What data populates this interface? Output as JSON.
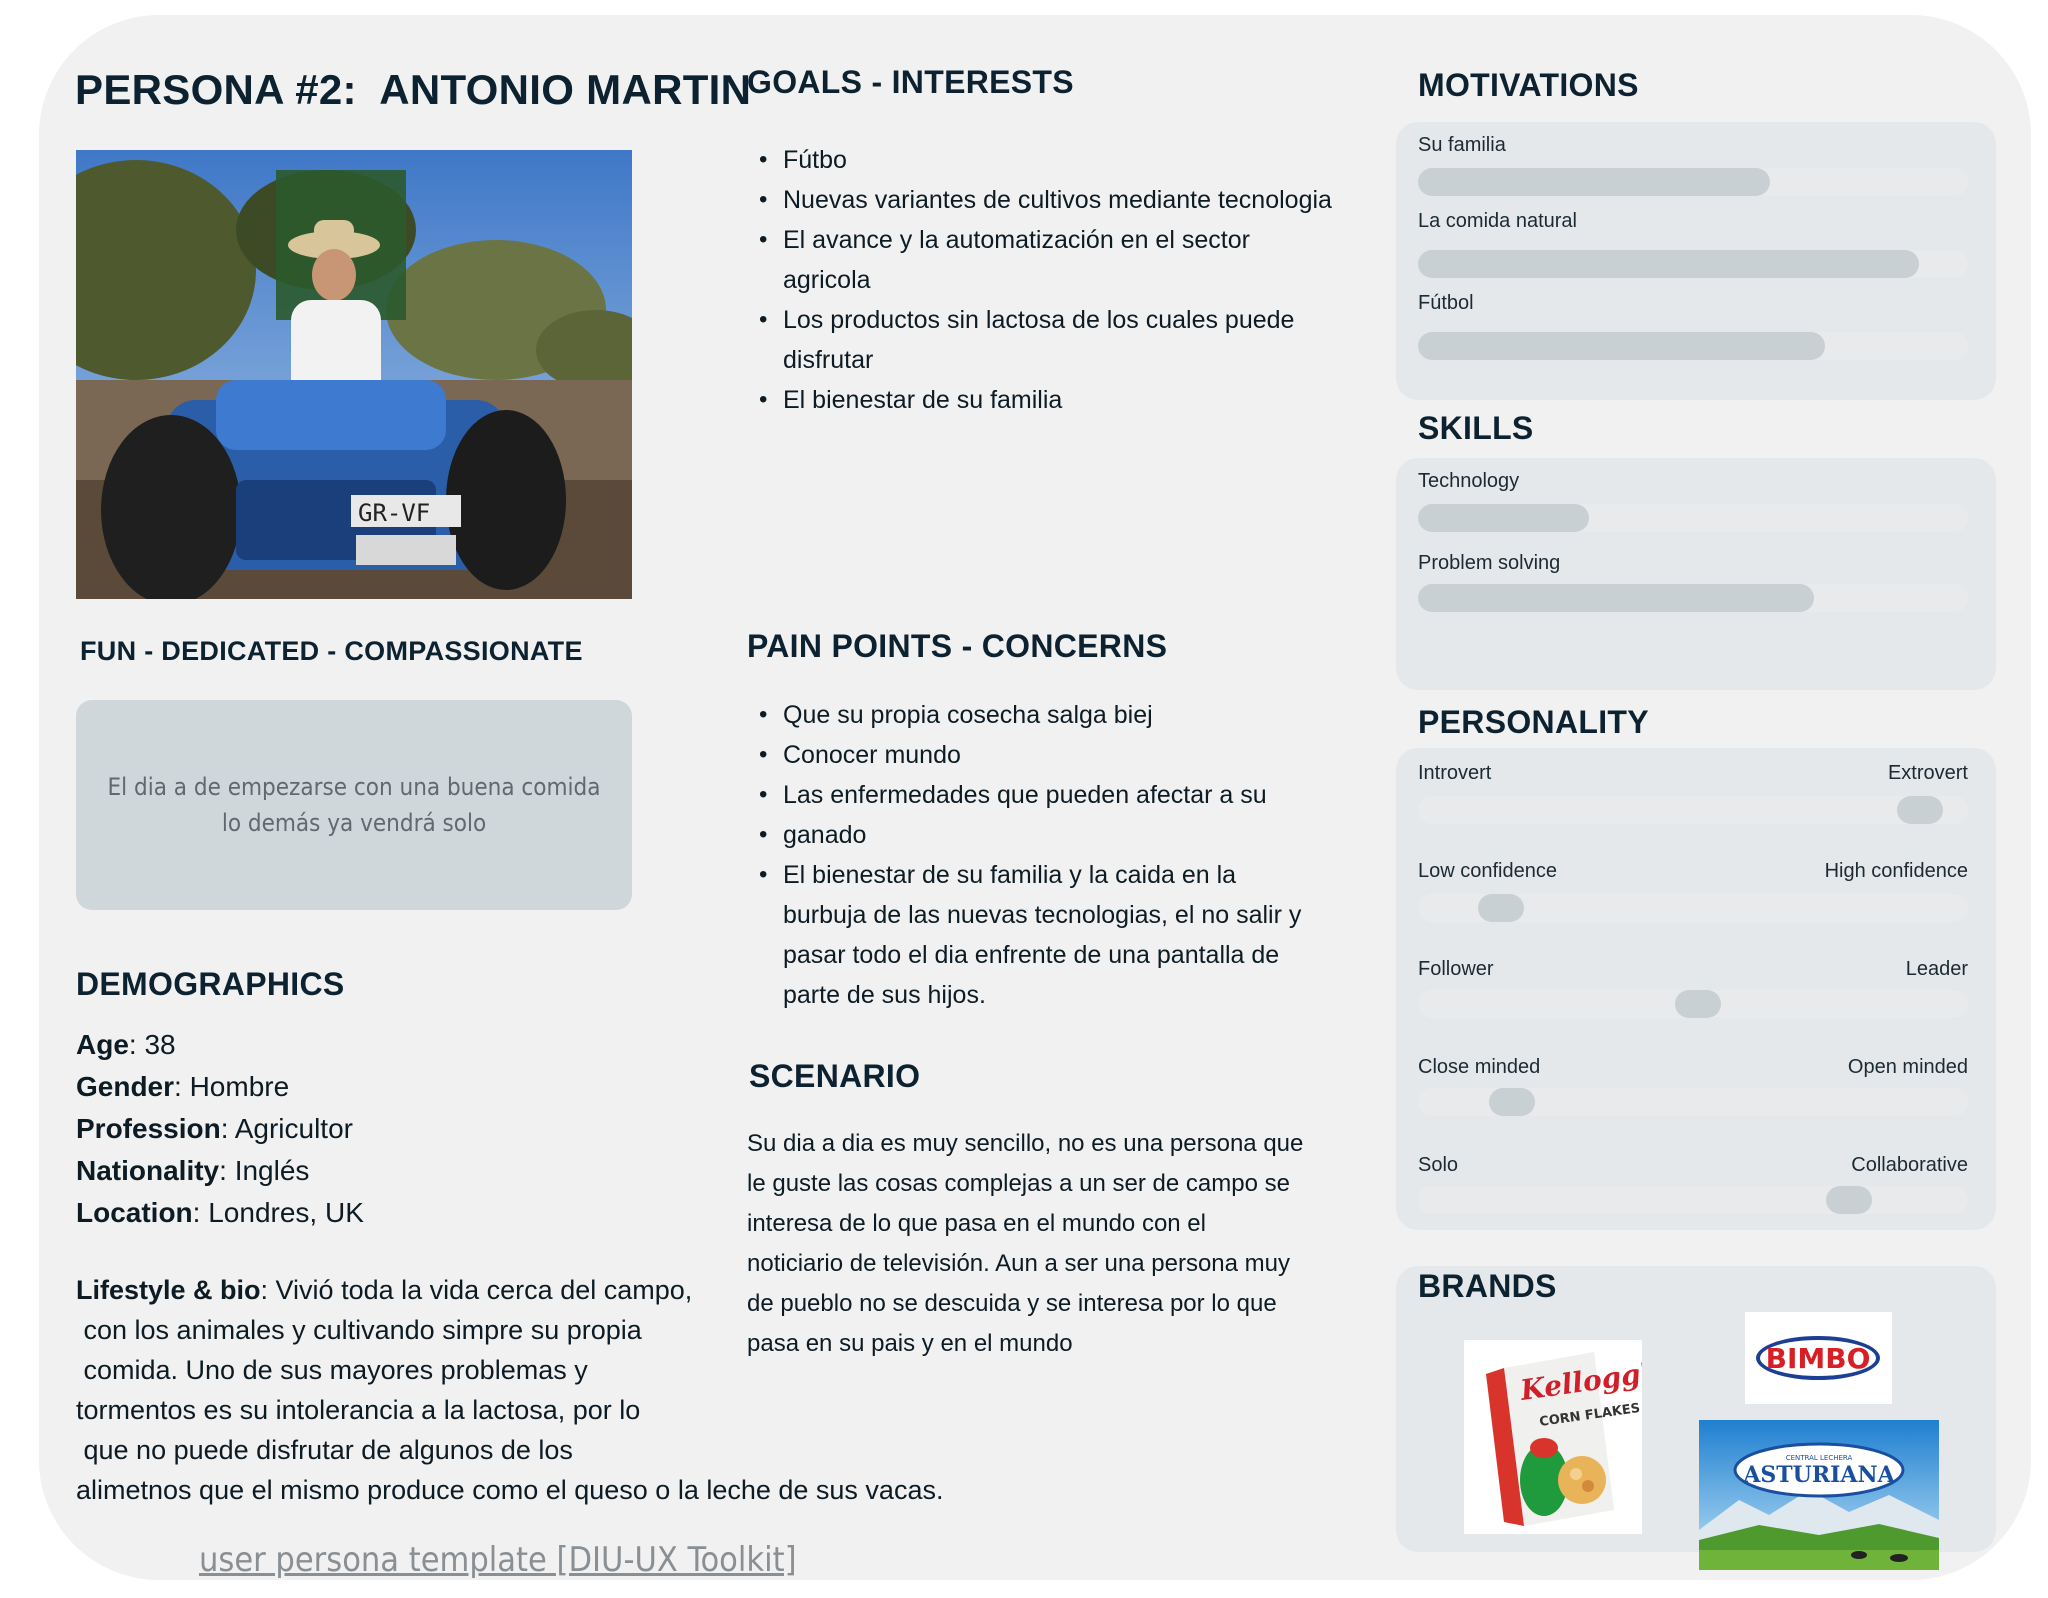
{
  "persona": {
    "title": "PERSONA #2:  ANTONIO MARTIN",
    "traits": "FUN - DEDICATED - COMPASSIONATE",
    "quote": "El dia a de empezarse con una buena comida lo demás ya vendrá solo"
  },
  "demographics": {
    "heading": "DEMOGRAPHICS",
    "rows": [
      {
        "label": "Age",
        "value": ": 38"
      },
      {
        "label": "Gender",
        "value": ": Hombre"
      },
      {
        "label": "Profession",
        "value": ": Agricultor"
      },
      {
        "label": "Nationality",
        "value": ": Inglés"
      },
      {
        "label": "Location",
        "value": ": Londres, UK"
      }
    ]
  },
  "bio": {
    "label": "Lifestyle & bio",
    "text": ": Vivió toda la vida cerca del campo,\n con los animales y cultivando simpre su propia\n comida. Uno de sus mayores problemas y\ntormentos es su intolerancia a la lactosa, por lo\n que no puede disfrutar de algunos de los\nalimetnos que el mismo produce como el queso o la leche de sus vacas."
  },
  "goals": {
    "heading": "GOALS - INTERESTS",
    "items": [
      "Fútbo",
      "Nuevas variantes de cultivos mediante tecnologia",
      "El avance y la automatización en el sector agricola",
      "Los productos sin lactosa de los cuales puede disfrutar",
      "El bienestar de su familia"
    ]
  },
  "pain_points": {
    "heading": "PAIN POINTS - CONCERNS",
    "items": [
      "Que su propia cosecha salga biej",
      "Conocer mundo",
      "Las enfermedades que pueden afectar a su",
      "ganado",
      "El bienestar de su familia y la caida en la burbuja de las nuevas tecnologias, el no salir y pasar todo el dia enfrente de una pantalla de parte de sus hijos."
    ]
  },
  "scenario": {
    "heading": "SCENARIO",
    "text": "Su dia a dia es muy sencillo, no es una persona que le guste las cosas complejas a un ser de campo se interesa de lo que pasa en el mundo con el noticiario de televisión. Aun a ser una persona muy de pueblo no se descuida y se interesa por lo que pasa en su pais y en el mundo"
  },
  "motivations": {
    "heading": "MOTIVATIONS",
    "items": [
      {
        "label": "Su familia",
        "value": 0.64
      },
      {
        "label": "La comida natural",
        "value": 0.91
      },
      {
        "label": "Fútbol",
        "value": 0.74
      }
    ]
  },
  "skills": {
    "heading": "SKILLS",
    "items": [
      {
        "label": "Technology",
        "value": 0.31
      },
      {
        "label": "Problem solving",
        "value": 0.72
      }
    ]
  },
  "personality": {
    "heading": "PERSONALITY",
    "items": [
      {
        "left": "Introvert",
        "right": "Extrovert",
        "value": 0.95
      },
      {
        "left": "Low confidence",
        "right": "High confidence",
        "value": 0.12
      },
      {
        "left": "Follower",
        "right": "Leader",
        "value": 0.51
      },
      {
        "left": "Close minded",
        "right": "Open minded",
        "value": 0.14
      },
      {
        "left": "Solo",
        "right": "Collaborative",
        "value": 0.81
      }
    ]
  },
  "brands": {
    "heading": "BRANDS",
    "logos": [
      "Kellogg's",
      "CORN FLAKES",
      "BIMBO",
      "CENTRAL LECHERA",
      "ASTURIANA"
    ]
  },
  "footer": {
    "link": "user persona template [DIU-UX Toolkit]"
  },
  "colors": {
    "card_bg": "#f1f1f1",
    "panel_bg": "#e5e8ea",
    "bar_fill": "#c9d0d3",
    "heading": "#0d2230"
  },
  "icons": [
    "persona-photo",
    "kelloggs-logo",
    "bimbo-logo",
    "asturiana-logo"
  ]
}
